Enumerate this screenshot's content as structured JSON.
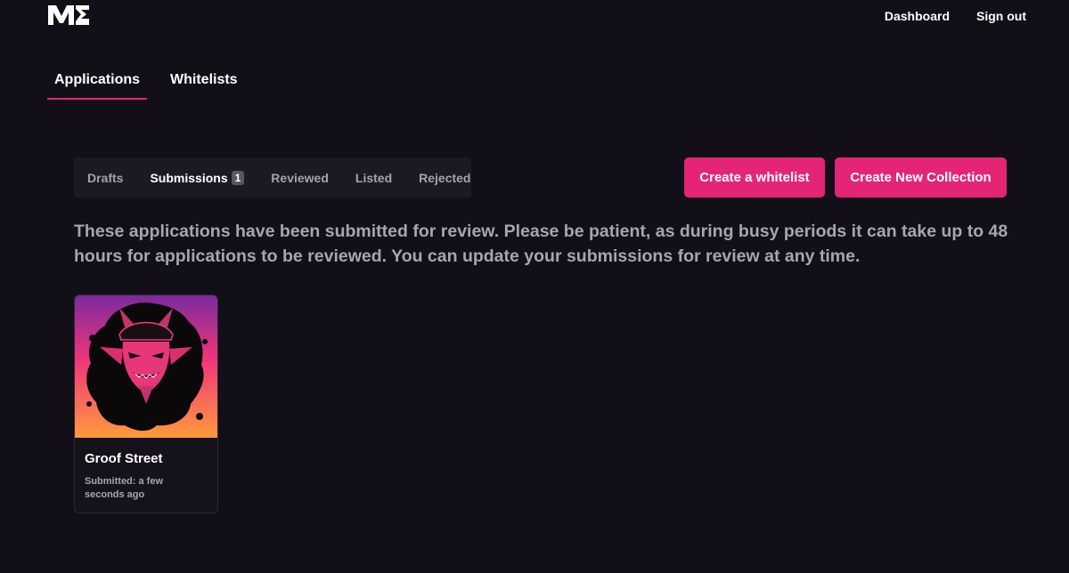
{
  "header": {
    "logo": "ME",
    "nav": [
      {
        "label": "Dashboard"
      },
      {
        "label": "Sign out"
      }
    ]
  },
  "main_tabs": [
    {
      "label": "Applications",
      "active": true
    },
    {
      "label": "Whitelists",
      "active": false
    }
  ],
  "filter_tabs": [
    {
      "label": "Drafts",
      "active": false
    },
    {
      "label": "Submissions",
      "active": true,
      "count": "1"
    },
    {
      "label": "Reviewed",
      "active": false
    },
    {
      "label": "Listed",
      "active": false
    },
    {
      "label": "Rejected",
      "active": false
    }
  ],
  "actions": {
    "create_whitelist": "Create a whitelist",
    "create_collection": "Create New Collection"
  },
  "description": "These applications have been submitted for review. Please be patient, as during busy periods it can take up to 48 hours for applications to be reviewed. You can update your submissions for review at any time.",
  "cards": [
    {
      "title": "Groof Street",
      "status": "Submitted: a few seconds ago"
    }
  ],
  "colors": {
    "background": "#120f18",
    "accent": "#e42575",
    "tab_bar": "#1a1a25",
    "muted_text": "#a7a5ae"
  }
}
